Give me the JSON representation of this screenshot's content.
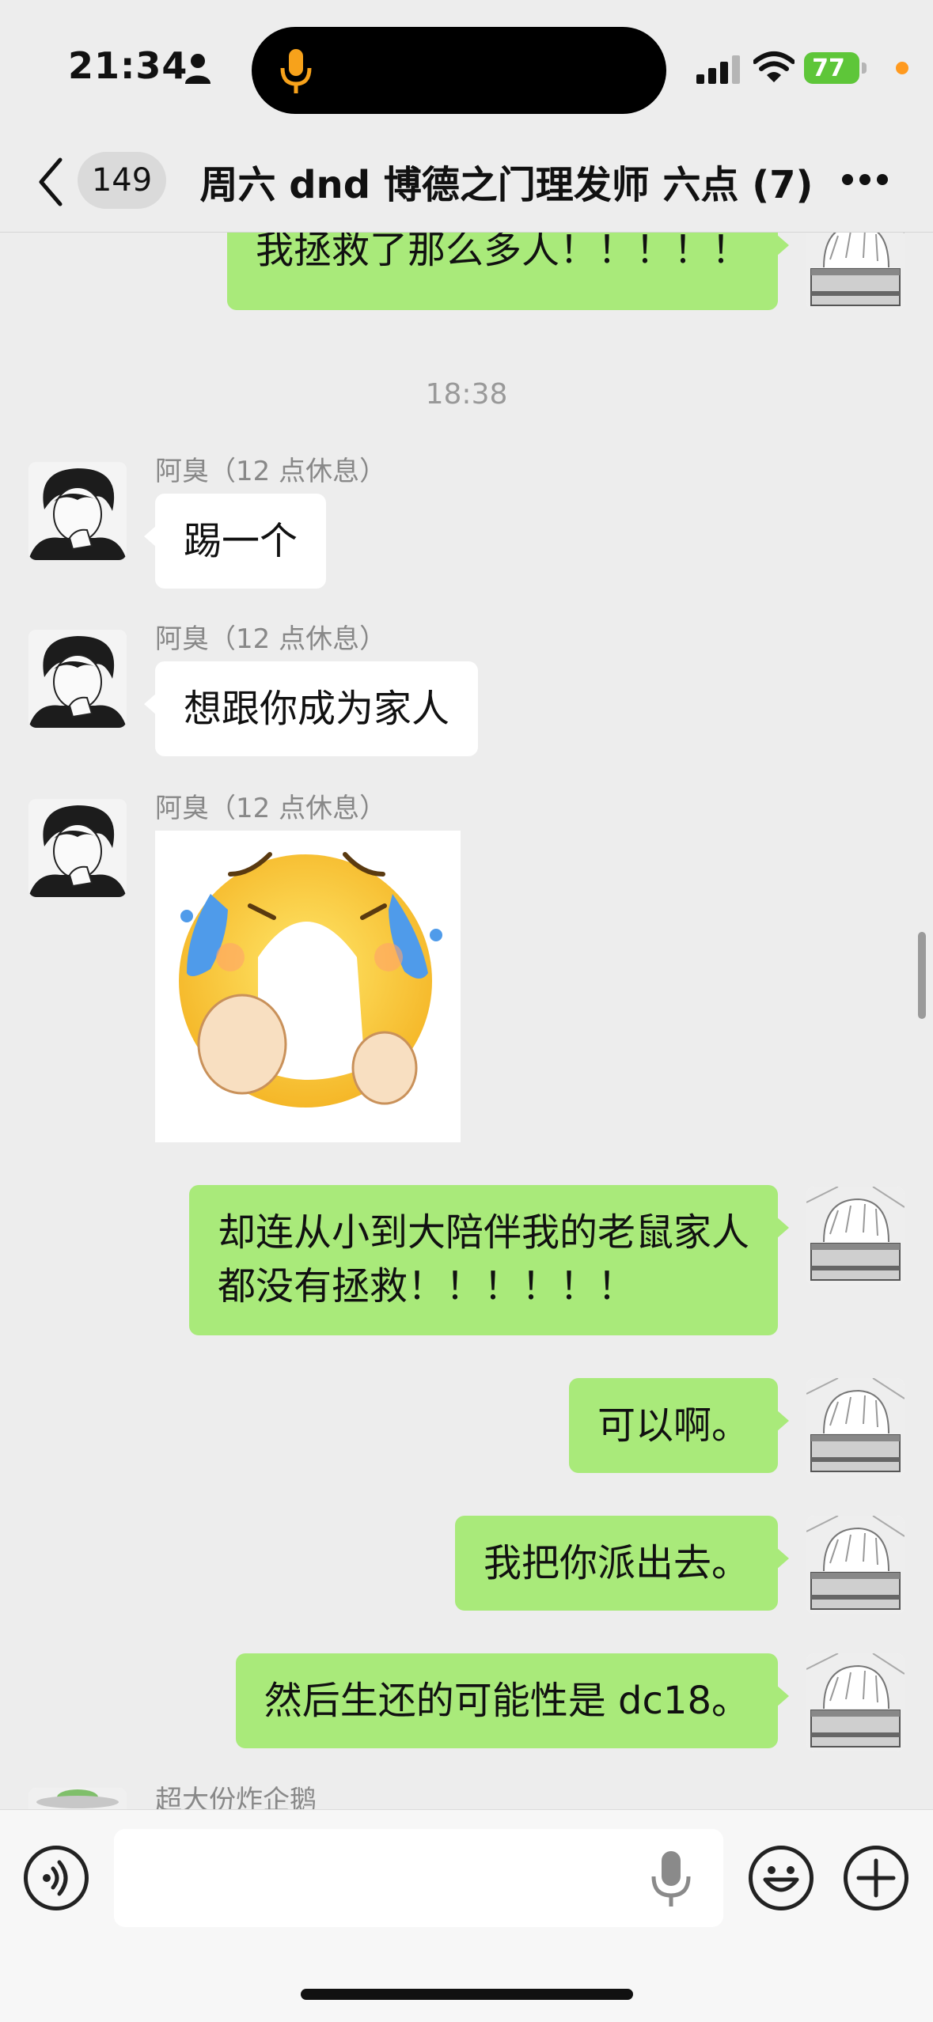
{
  "status_bar": {
    "time": "21:34",
    "battery": "77",
    "icons": [
      "person-icon",
      "microphone-indicator-icon",
      "cellular-signal-icon",
      "wifi-icon",
      "battery-charging-icon"
    ],
    "colors": {
      "battery": "#5ec639",
      "mic_indicator": "#f7a21b",
      "privacy_dot": "#ff9a1f"
    }
  },
  "nav": {
    "unread_count": "149",
    "title": "周六 dnd 博德之门理发师 六点 (7)",
    "icons": [
      "chevron-left-icon",
      "more-icon"
    ]
  },
  "messages": [
    {
      "type": "text",
      "side": "right",
      "text": "我拯救了那么多人！！！！！"
    },
    {
      "type": "time",
      "text": "18:38"
    },
    {
      "type": "text",
      "side": "left",
      "sender": "阿臭（12 点休息）",
      "text": "踢一个"
    },
    {
      "type": "text",
      "side": "left",
      "sender": "阿臭（12 点休息）",
      "text": "想跟你成为家人"
    },
    {
      "type": "sticker",
      "side": "left",
      "sender": "阿臭（12 点休息）",
      "sticker": "crying-emoji-sticker"
    },
    {
      "type": "text",
      "side": "right",
      "lines": [
        "却连从小到大陪伴我的老鼠家人",
        "都没有拯救！！！！！！"
      ]
    },
    {
      "type": "text",
      "side": "right",
      "text": "可以啊。"
    },
    {
      "type": "text",
      "side": "right",
      "text": "我把你派出去。"
    },
    {
      "type": "text",
      "side": "right",
      "text": "然后生还的可能性是 dc18。"
    },
    {
      "type": "partial",
      "side": "left",
      "sender": "超大份炸企鹅"
    }
  ],
  "input_bar": {
    "placeholder": "",
    "icons": [
      "voice-mode-icon",
      "microphone-icon",
      "emoji-icon",
      "plus-icon"
    ]
  },
  "colors": {
    "background": "#ededed",
    "bubble_self": "#a9ea7a",
    "bubble_other": "#ffffff",
    "sender_text": "#888888"
  }
}
